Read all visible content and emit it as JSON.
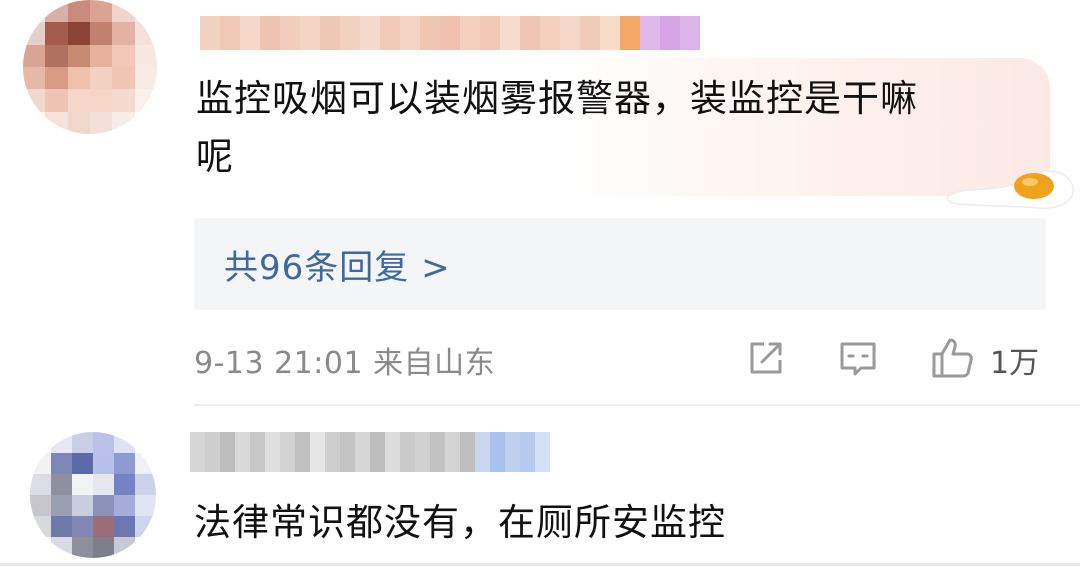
{
  "comments": [
    {
      "text_line1": "监控吸烟可以装烟雾报警器，装监控是干嘛",
      "text_line2": "呢",
      "replies_label": "共96条回复 >",
      "meta": "9-13 21:01 来自山东",
      "like_count": "1万",
      "avatar_colors": [
        "#f1e6e2",
        "#d9b1a6",
        "#ca8a7c",
        "#dba393",
        "#efd4c9",
        "#f6ebe7",
        "#e5cfc9",
        "#a45a4c",
        "#8a4337",
        "#c2806e",
        "#e2b3a3",
        "#f4e2da",
        "#d9a493",
        "#b07260",
        "#c98a74",
        "#e7b19d",
        "#f2c9b8",
        "#f7e8e1",
        "#e6b8a6",
        "#d89c86",
        "#eec1ab",
        "#f4d2c2",
        "#efc5b3",
        "#f8ebe5",
        "#f2d8cc",
        "#eec4b4",
        "#f5d6c8",
        "#f6d5c6",
        "#f3dbd0",
        "#fbf1ec",
        "#fbf3ef",
        "#f5e2da",
        "#f0d7cc",
        "#f3e0d8",
        "#f8eee9",
        "#ffffff"
      ],
      "name_colors": [
        "#f3d2c2",
        "#f0c8b6",
        "#f6d8c8",
        "#eec3b0",
        "#f2cdbc",
        "#f5d4c4",
        "#efc8b5",
        "#f3cfbd",
        "#f6dacb",
        "#f1cab8",
        "#f4d3c3",
        "#f0c6b3",
        "#eec0ad",
        "#f5d0be",
        "#f2c9b5",
        "#f7dccd",
        "#efc6b3",
        "#f4cfbc",
        "#f6d6c6",
        "#f1cbb9",
        "#f8dbc9",
        "#f3a868",
        "#e0b8ec",
        "#d7a4e6",
        "#dcb3ea"
      ]
    },
    {
      "text": "法律常识都没有，在厕所安监控",
      "avatar_colors": [
        "#ffffff",
        "#e6e7ef",
        "#c9cfe6",
        "#b9c3e9",
        "#dee2f3",
        "#ffffff",
        "#f2f2f5",
        "#7c87b8",
        "#5d6aa8",
        "#b7c0e8",
        "#8e9bd3",
        "#f0f1f8",
        "#dcdde4",
        "#8f8f9e",
        "#f3f3f6",
        "#e5e6ee",
        "#7482c6",
        "#ccd2ee",
        "#c6c6cc",
        "#9b9fb2",
        "#c9cde0",
        "#8a92bc",
        "#a4adda",
        "#e1e4f3",
        "#d8d9dd",
        "#6f7aaa",
        "#8288b6",
        "#9b6d7a",
        "#6c76b2",
        "#d0d5ee",
        "#ffffff",
        "#d9dbe6",
        "#8e8f9a",
        "#7f7f8a",
        "#c7c9d6",
        "#ffffff"
      ],
      "name_colors": [
        "#d6d6d6",
        "#cfcfcf",
        "#bdbdbd",
        "#d9d9d9",
        "#c7c7c7",
        "#dedede",
        "#d2d2d2",
        "#c0c0c0",
        "#e6e6e6",
        "#cfcfcf",
        "#c4c4c4",
        "#d6d6d6",
        "#bdbdbd",
        "#dcdcdc",
        "#cacaca",
        "#d1d1d1",
        "#c2c2c2",
        "#d4d4d4",
        "#bfbfbf",
        "#c8d6ef",
        "#a9c1ec",
        "#bfd0f0",
        "#b5caee",
        "#d3e0f5"
      ]
    }
  ],
  "colors": {
    "link": "#41689c",
    "meta": "#8a8a8a",
    "icon": "#9a9a9a"
  },
  "icons": {
    "share": "share-icon",
    "comment": "comment-icon",
    "like": "thumbs-up-icon",
    "sticker": "fried-egg-icon"
  }
}
